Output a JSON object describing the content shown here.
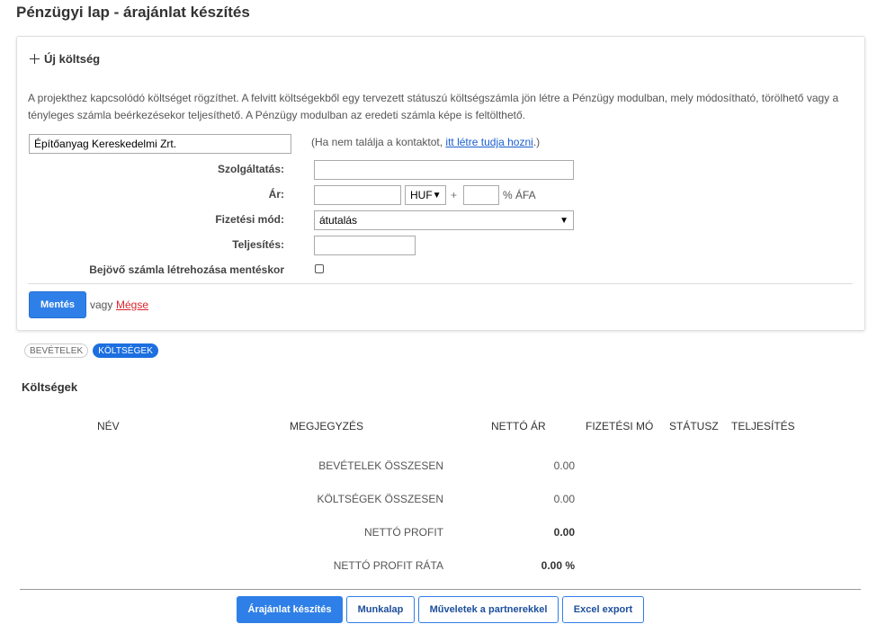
{
  "page": {
    "title": "Pénzügyi lap - árajánlat készítés"
  },
  "new_cost": {
    "title": "Új költség",
    "description": "A projekthez kapcsolódó költséget rögzíthet. A felvitt költségekből egy tervezett státuszú költségszámla jön létre a Pénzügy modulban, mely módosítható, törölhető vagy a tényleges számla beérkezésekor teljesíthető. A Pénzügy modulban az eredeti számla képe is feltölthető.",
    "contact_value": "Építőanyag Kereskedelmi Zrt.",
    "contact_hint_prefix": "(Ha nem találja a kontaktot, ",
    "contact_hint_link": "itt létre tudja hozni",
    "contact_hint_suffix": ".)",
    "service_label": "Szolgáltatás:",
    "service_value": "",
    "price_label": "Ár:",
    "price_value": "",
    "currency": "HUF",
    "plus": "+",
    "vat_value": "",
    "vat_label": "% ÁFA",
    "payment_label": "Fizetési mód:",
    "payment_value": "átutalás",
    "completion_label": "Teljesítés:",
    "completion_value": "",
    "invoice_checkbox_label": "Bejövő számla létrehozása mentéskor",
    "invoice_checkbox_checked": false,
    "save_label": "Mentés",
    "or_label": "vagy",
    "cancel_label": "Mégse"
  },
  "tabs": [
    {
      "label": "BEVÉTELEK",
      "active": false
    },
    {
      "label": "KÖLTSÉGEK",
      "active": true
    }
  ],
  "costs": {
    "title": "Költségek",
    "columns": [
      "NÉV",
      "MEGJEGYZÉS",
      "NETTÓ ÁR",
      "FIZETÉSI MÓD",
      "STÁTUSZ",
      "TELJESÍTÉS"
    ],
    "summary": [
      {
        "label": "BEVÉTELEK ÖSSZESEN",
        "value": "0.00"
      },
      {
        "label": "KÖLTSÉGEK ÖSSZESEN",
        "value": "0.00"
      },
      {
        "label": "NETTÓ PROFIT",
        "value": "0.00"
      },
      {
        "label": "NETTÓ PROFIT RÁTA",
        "value": "0.00 %"
      }
    ]
  },
  "bottom_buttons": {
    "quote": "Árajánlat készítés",
    "worksheet": "Munkalap",
    "partner_ops": "Műveletek a partnerekkel",
    "excel": "Excel export"
  },
  "colors": {
    "accent": "#2f7fe8",
    "link": "#1a5fd1",
    "cancel": "#d9262e"
  }
}
